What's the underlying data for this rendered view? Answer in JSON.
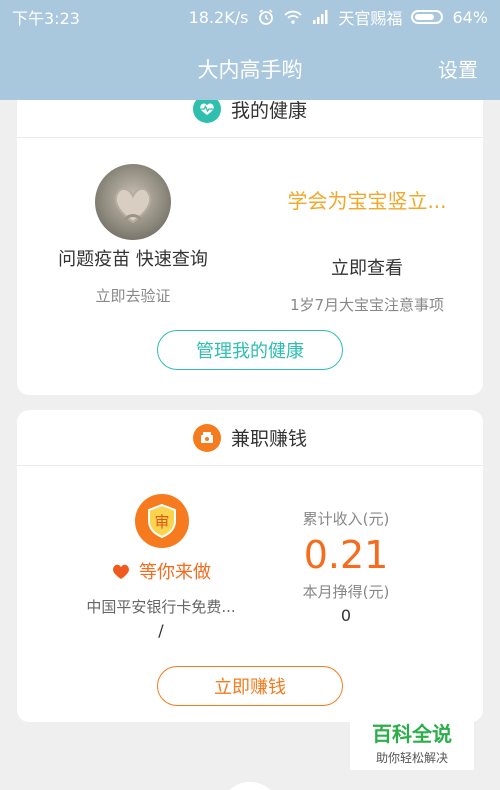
{
  "status_bar": {
    "time": "下午3:23",
    "speed": "18.2K/s",
    "carrier": "天官赐福",
    "battery": "64%",
    "battery_level": 0.64
  },
  "nav": {
    "title": "大内高手哟",
    "settings_label": "设置"
  },
  "health_card": {
    "header": "我的健康",
    "left": {
      "title": "问题疫苗 快速查询",
      "subtitle": "立即去验证"
    },
    "right": {
      "headline": "学会为宝宝竖立...",
      "title": "立即查看",
      "subtitle": "1岁7月大宝宝注意事项"
    },
    "button_label": "管理我的健康"
  },
  "earn_card": {
    "header": "兼职赚钱",
    "badge_char": "审",
    "waiting_label": "等你来做",
    "task_title": "中国平安银行卡免费...",
    "task_value": "/",
    "total_income_label": "累计收入(元)",
    "total_income_value": "0.21",
    "month_income_label": "本月挣得(元)",
    "month_income_value": "0",
    "button_label": "立即赚钱"
  },
  "watermark": {
    "title": "百科全说",
    "subtitle": "助你轻松解决"
  },
  "colors": {
    "nav_bg": "#a9c7dd",
    "teal": "#2fbfae",
    "orange": "#f57b1e",
    "yellow": "#f1a829"
  },
  "icons": {
    "health": "heart-pulse-icon",
    "earn": "money-box-icon",
    "badge": "shield-icon",
    "waiting": "heart-icon"
  }
}
